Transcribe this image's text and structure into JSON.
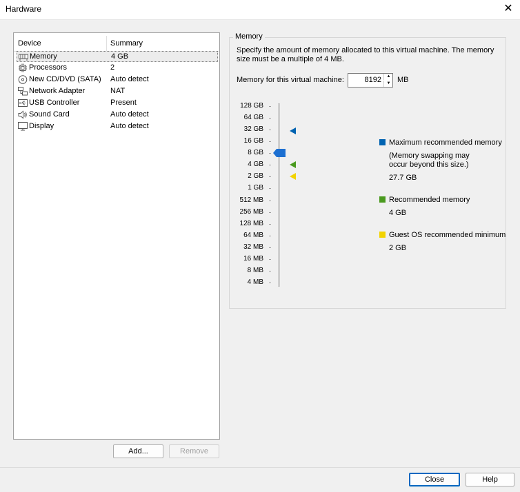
{
  "window": {
    "title": "Hardware"
  },
  "device_list": {
    "headers": [
      "Device",
      "Summary"
    ],
    "items": [
      {
        "name": "Memory",
        "summary": "4 GB",
        "icon": "memory-icon",
        "selected": true
      },
      {
        "name": "Processors",
        "summary": "2",
        "icon": "processor-icon"
      },
      {
        "name": "New CD/DVD (SATA)",
        "summary": "Auto detect",
        "icon": "cd-dvd-icon"
      },
      {
        "name": "Network Adapter",
        "summary": "NAT",
        "icon": "network-icon"
      },
      {
        "name": "USB Controller",
        "summary": "Present",
        "icon": "usb-icon"
      },
      {
        "name": "Sound Card",
        "summary": "Auto detect",
        "icon": "speaker-icon"
      },
      {
        "name": "Display",
        "summary": "Auto detect",
        "icon": "monitor-icon"
      }
    ]
  },
  "buttons": {
    "add": "Add...",
    "remove": "Remove",
    "close": "Close",
    "help": "Help"
  },
  "memory": {
    "group_title": "Memory",
    "description": "Specify the amount of memory allocated to this virtual machine. The memory size must be a multiple of 4 MB.",
    "field_label": "Memory for this virtual machine:",
    "value": "8192",
    "unit": "MB",
    "scale": [
      "128 GB",
      "64 GB",
      "32 GB",
      "16 GB",
      "8 GB",
      "4 GB",
      "2 GB",
      "1 GB",
      "512 MB",
      "256 MB",
      "128 MB",
      "64 MB",
      "32 MB",
      "16 MB",
      "8 MB",
      "4 MB"
    ],
    "slider_selected_tick": "8 GB",
    "legend": {
      "max": {
        "label": "Maximum recommended memory",
        "note_line1": "(Memory swapping may",
        "note_line2": "occur beyond this size.)",
        "value": "27.7 GB",
        "color": "#0063b1",
        "tick": "32 GB"
      },
      "rec": {
        "label": "Recommended memory",
        "value": "4 GB",
        "color": "#4a9a1f",
        "tick": "4 GB"
      },
      "min": {
        "label": "Guest OS recommended minimum",
        "value": "2 GB",
        "color": "#f2d300",
        "tick": "2 GB"
      }
    },
    "thumb_color": "#1c6fd1"
  }
}
